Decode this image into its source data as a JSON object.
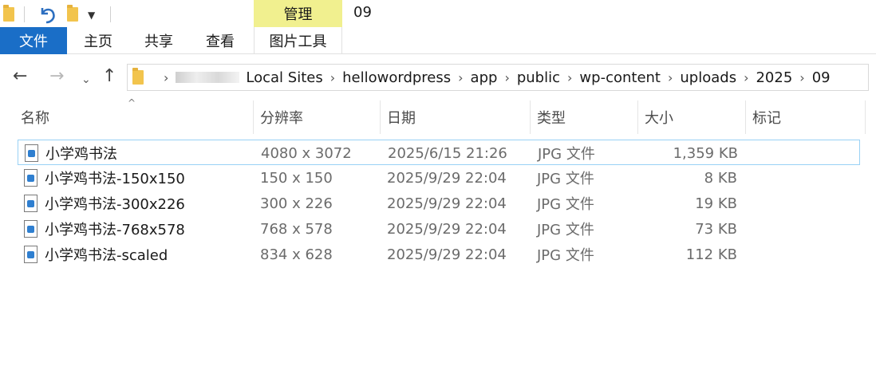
{
  "window": {
    "title": "09"
  },
  "ribbon": {
    "context_header": "管理",
    "tabs": [
      {
        "label": "文件"
      },
      {
        "label": "主页"
      },
      {
        "label": "共享"
      },
      {
        "label": "查看"
      },
      {
        "label": "图片工具"
      }
    ]
  },
  "address": {
    "segments": [
      "Local Sites",
      "hellowordpress",
      "app",
      "public",
      "wp-content",
      "uploads",
      "2025",
      "09"
    ]
  },
  "columns": [
    "名称",
    "分辨率",
    "日期",
    "类型",
    "大小",
    "标记"
  ],
  "files": [
    {
      "name": "小学鸡书法",
      "dimensions": "4080 x 3072",
      "date": "2025/6/15 21:26",
      "type": "JPG 文件",
      "size": "1,359 KB"
    },
    {
      "name": "小学鸡书法-150x150",
      "dimensions": "150 x 150",
      "date": "2025/9/29 22:04",
      "type": "JPG 文件",
      "size": "8 KB"
    },
    {
      "name": "小学鸡书法-300x226",
      "dimensions": "300 x 226",
      "date": "2025/9/29 22:04",
      "type": "JPG 文件",
      "size": "19 KB"
    },
    {
      "name": "小学鸡书法-768x578",
      "dimensions": "768 x 578",
      "date": "2025/9/29 22:04",
      "type": "JPG 文件",
      "size": "73 KB"
    },
    {
      "name": "小学鸡书法-scaled",
      "dimensions": "834 x 628",
      "date": "2025/9/29 22:04",
      "type": "JPG 文件",
      "size": "112 KB"
    }
  ],
  "colors": {
    "accent": "#1a6ec7",
    "context_tab": "#f1f08f",
    "selection_border": "#99d1f5"
  }
}
